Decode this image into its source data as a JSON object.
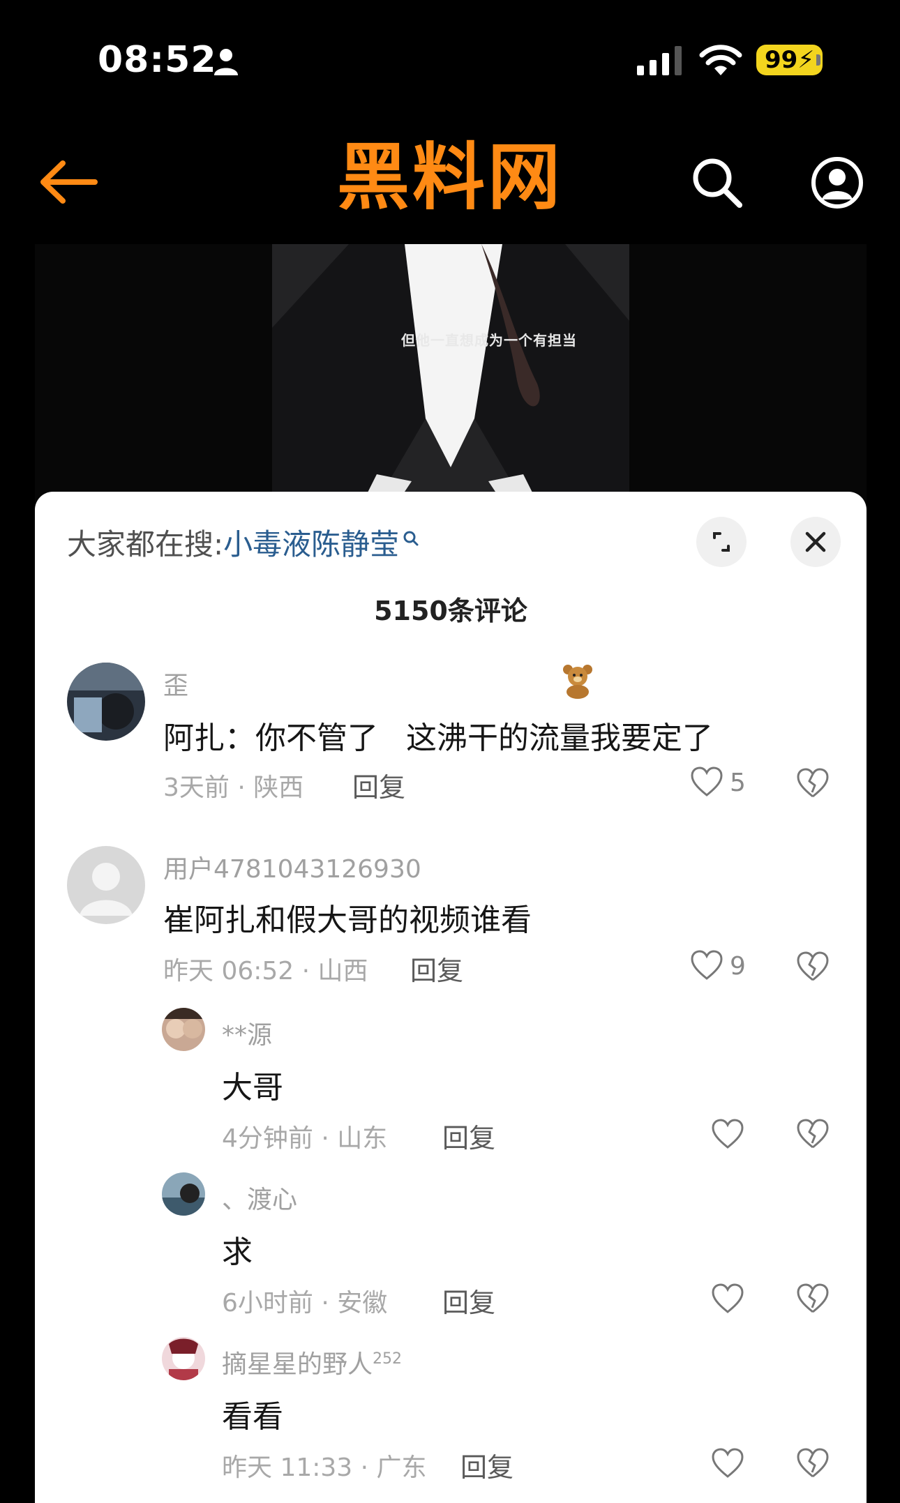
{
  "status_bar": {
    "time": "08:52",
    "battery": "99"
  },
  "header": {
    "title": "黑料网"
  },
  "video": {
    "subtitle": "但他一直想成为一个有担当"
  },
  "panel": {
    "search_prefix": "大家都在搜:",
    "search_term": "小毒液陈静莹",
    "comment_count": "5150条评论"
  },
  "comments": [
    {
      "username": "歪",
      "text_before": "阿扎：你不管了",
      "text_after": "这沸干的流量我要定了",
      "time_location": "3天前 · 陕西",
      "reply_label": "回复",
      "likes": "5"
    },
    {
      "username": "用户4781043126930",
      "text": "崔阿扎和假大哥的视频谁看",
      "time_location": "昨天 06:52 · 山西",
      "reply_label": "回复",
      "likes": "9"
    }
  ],
  "replies": [
    {
      "username": "**源",
      "text": "大哥",
      "time_location": "4分钟前 · 山东",
      "reply_label": "回复"
    },
    {
      "username": "、渡心",
      "text": "求",
      "time_location": "6小时前 · 安徽",
      "reply_label": "回复"
    },
    {
      "username": "摘星星的野人",
      "username_badge": "252",
      "text": "看看",
      "time_location": "昨天 11:33 · 广东",
      "reply_label": "回复"
    }
  ],
  "colors": {
    "brand_orange": "#ff8a14",
    "battery_yellow": "#f3d51e",
    "search_term_blue": "#2a5d8f"
  },
  "icons": {
    "back": "arrow-left-icon",
    "search": "search-icon",
    "profile": "user-circle-icon",
    "expand": "expand-icon",
    "close": "close-icon",
    "like": "heart-icon",
    "dislike": "broken-heart-icon",
    "sticker": "teddy-bear-icon"
  }
}
